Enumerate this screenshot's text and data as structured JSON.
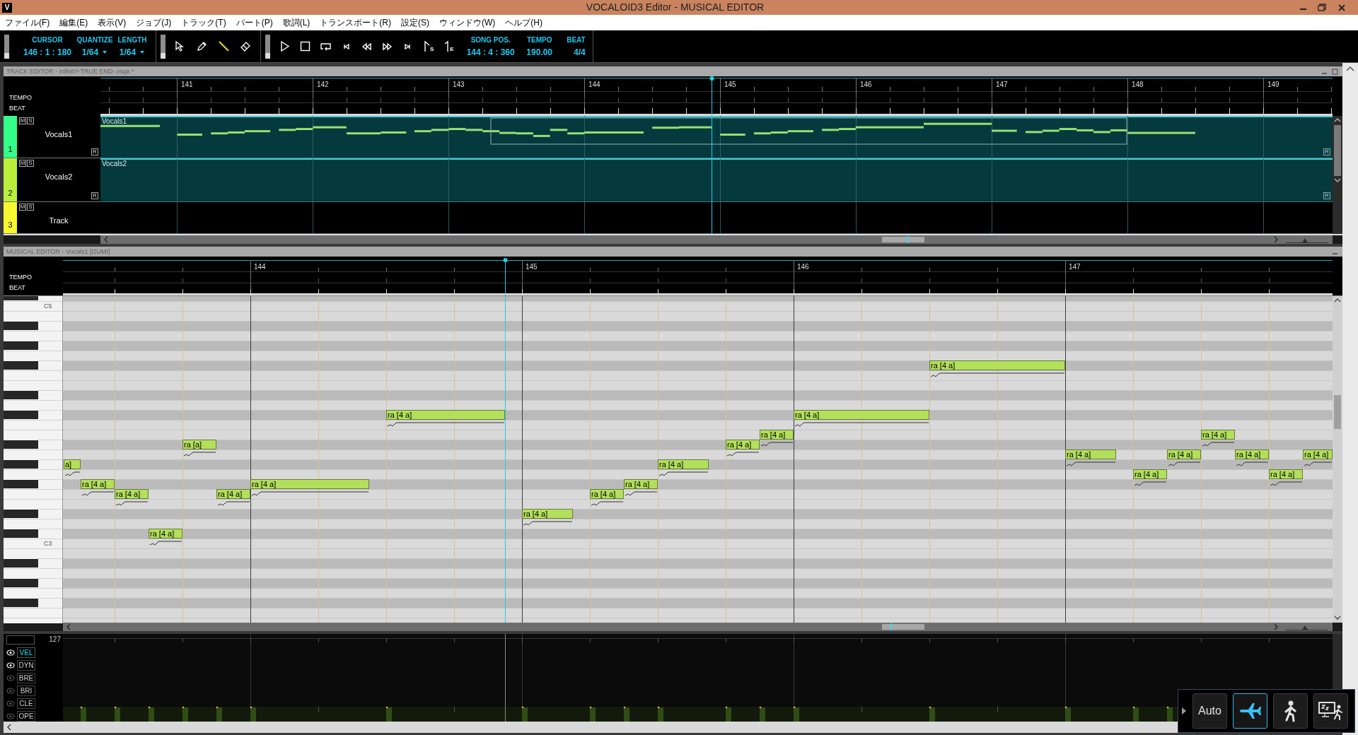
{
  "window": {
    "logo": "V",
    "title": "VOCALOID3 Editor - MUSICAL EDITOR"
  },
  "menu": [
    "ファイル(F)",
    "編集(E)",
    "表示(V)",
    "ジョブ(J)",
    "トラック(T)",
    "パート(P)",
    "歌詞(L)",
    "トランスポート(R)",
    "設定(S)",
    "ウィンドウ(W)",
    "ヘルプ(H)"
  ],
  "toolbar": {
    "cursor": {
      "label": "CURSOR",
      "value": "146 : 1 : 180"
    },
    "quantize": {
      "label": "QUANTIZE",
      "value": "1/64"
    },
    "length": {
      "label": "LENGTH",
      "value": "1/64"
    },
    "tools": [
      {
        "kind": "pointer",
        "selected": false
      },
      {
        "kind": "pencil",
        "selected": false
      },
      {
        "kind": "line",
        "selected": true
      },
      {
        "kind": "eraser",
        "selected": false
      }
    ],
    "transport": [
      {
        "kind": "play"
      },
      {
        "kind": "stop"
      },
      {
        "kind": "loop"
      },
      {
        "kind": "to-start"
      },
      {
        "kind": "rewind"
      },
      {
        "kind": "forward"
      },
      {
        "kind": "to-end"
      },
      {
        "kind": "start-marker",
        "label": "S"
      },
      {
        "kind": "end-marker",
        "label": "E"
      }
    ],
    "song_pos": {
      "label": "SONG POS.",
      "value": "144 : 4 : 360"
    },
    "tempo": {
      "label": "TEMPO",
      "value": "190.00"
    },
    "beat": {
      "label": "BEAT",
      "value": "4/4"
    }
  },
  "track_editor": {
    "title": "TRACK EDITOR - InfinitY-TRUE END-.vsqx *",
    "zoom": {
      "level": 0.45
    },
    "ruler_labels": [
      "TEMPO",
      "BEAT"
    ],
    "bars": [
      "141",
      "142",
      "143",
      "144",
      "145",
      "146",
      "147",
      "148",
      "149"
    ],
    "tracks": [
      {
        "number": "1",
        "name": "Vocals1",
        "color": "#33ff88",
        "buttons": [
          "M",
          "S"
        ],
        "record_button": "R",
        "part": {
          "name": "Vocals1",
          "end_button": "R"
        }
      },
      {
        "number": "2",
        "name": "Vocals2",
        "color": "#b8f03c",
        "buttons": [
          "M",
          "S"
        ],
        "record_button": "R",
        "part": {
          "name": "Vocals2",
          "end_button": "R"
        }
      },
      {
        "number": "3",
        "name": "Track",
        "color": "#f8f830",
        "buttons": [
          "M",
          "S"
        ]
      }
    ]
  },
  "musical_editor": {
    "title": "MUSICAL EDITOR - Vocals1 [GUMI]",
    "zoom": {
      "level": 0.45
    },
    "ruler_labels": [
      "TEMPO",
      "BEAT"
    ],
    "bars": [
      "144",
      "145",
      "146",
      "147"
    ],
    "key_labels": [
      "C5",
      "C3"
    ],
    "notes": [
      {
        "lyric": "a]"
      },
      {
        "lyric": "ra [4 a]"
      },
      {
        "lyric": "ra [4 a]"
      },
      {
        "lyric": "ra [4 a]"
      },
      {
        "lyric": "ra [a]"
      },
      {
        "lyric": "ra [4 a]"
      },
      {
        "lyric": "ra [4 a]"
      },
      {
        "lyric": "ra [4 a]"
      },
      {
        "lyric": "ra [4 a]"
      },
      {
        "lyric": "ra [4 a]"
      },
      {
        "lyric": "ra [4 a]"
      },
      {
        "lyric": "ra [4 a]"
      },
      {
        "lyric": "ra [4 a]"
      },
      {
        "lyric": "ra [4 a]"
      },
      {
        "lyric": "ra [4 a]"
      },
      {
        "lyric": "ra [4 a]"
      },
      {
        "lyric": "ra [4 a]"
      },
      {
        "lyric": "ra [4 a]"
      },
      {
        "lyric": "ra [4 a]"
      },
      {
        "lyric": "ra [4 a]"
      },
      {
        "lyric": "ra [4 a]"
      },
      {
        "lyric": "ra [4 a]"
      },
      {
        "lyric": "ra [4 a]"
      }
    ]
  },
  "control_track": {
    "max": "127",
    "lanes": [
      {
        "label": "VEL",
        "visible": true,
        "selected": true
      },
      {
        "label": "DYN",
        "visible": true,
        "selected": false
      },
      {
        "label": "BRE",
        "visible": false,
        "selected": false
      },
      {
        "label": "BRI",
        "visible": false,
        "selected": false
      },
      {
        "label": "CLE",
        "visible": false,
        "selected": false
      },
      {
        "label": "OPE",
        "visible": false,
        "selected": false
      }
    ]
  },
  "mode_panel": {
    "buttons": [
      {
        "kind": "auto",
        "label": "Auto",
        "selected": false
      },
      {
        "kind": "airplane",
        "selected": true
      },
      {
        "kind": "walking",
        "selected": false
      },
      {
        "kind": "sleep",
        "selected": false
      }
    ]
  }
}
